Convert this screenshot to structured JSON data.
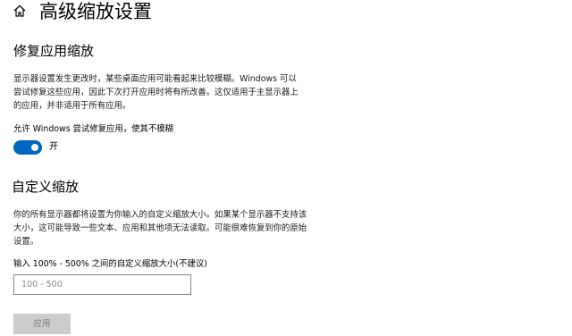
{
  "header": {
    "title": "高级缩放设置"
  },
  "fix_section": {
    "title": "修复应用缩放",
    "description": "显示器设置发生更改时，某些桌面应用可能看起来比较模糊。Windows 可以尝试修复这些应用，因此下次打开应用时将有所改善。这仅适用于主显示器上的应用，并非适用于所有应用。",
    "toggle_label": "允许 Windows 尝试修复应用，使其不模糊",
    "toggle_state_text": "开",
    "toggle_on": true,
    "toggle_color": "#0067c0"
  },
  "custom_section": {
    "title": "自定义缩放",
    "description": "你的所有显示器都将设置为你输入的自定义缩放大小。如果某个显示器不支持该大小，这可能导致一些文本、应用和其他项无法读取。可能很难恢复到你的原始设置。",
    "input_label": "输入 100% - 500% 之间的自定义缩放大小(不建议)",
    "input_placeholder": "100 - 500",
    "input_value": "",
    "apply_label": "应用"
  }
}
